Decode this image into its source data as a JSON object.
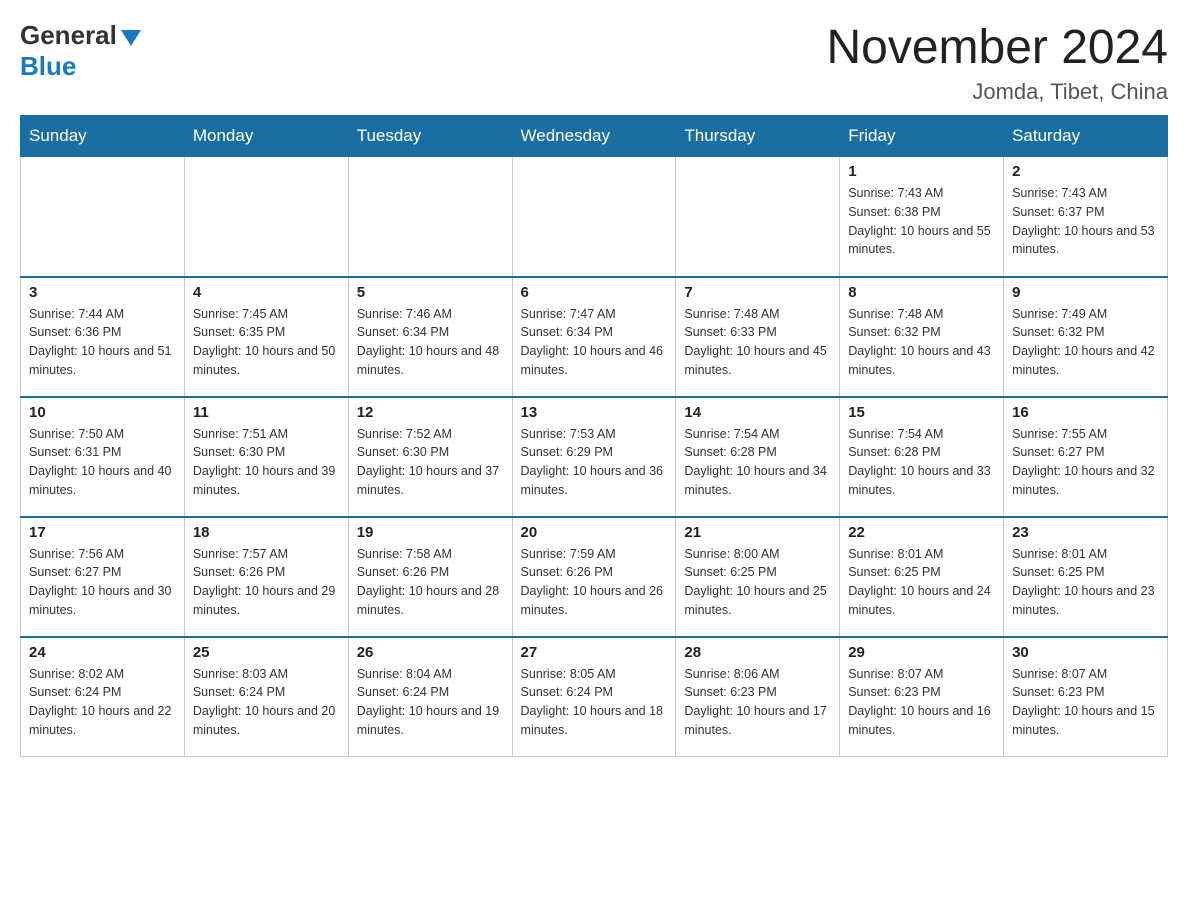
{
  "logo": {
    "general": "General",
    "blue": "Blue"
  },
  "title": "November 2024",
  "location": "Jomda, Tibet, China",
  "days_of_week": [
    "Sunday",
    "Monday",
    "Tuesday",
    "Wednesday",
    "Thursday",
    "Friday",
    "Saturday"
  ],
  "weeks": [
    [
      {
        "day": "",
        "info": ""
      },
      {
        "day": "",
        "info": ""
      },
      {
        "day": "",
        "info": ""
      },
      {
        "day": "",
        "info": ""
      },
      {
        "day": "",
        "info": ""
      },
      {
        "day": "1",
        "info": "Sunrise: 7:43 AM\nSunset: 6:38 PM\nDaylight: 10 hours and 55 minutes."
      },
      {
        "day": "2",
        "info": "Sunrise: 7:43 AM\nSunset: 6:37 PM\nDaylight: 10 hours and 53 minutes."
      }
    ],
    [
      {
        "day": "3",
        "info": "Sunrise: 7:44 AM\nSunset: 6:36 PM\nDaylight: 10 hours and 51 minutes."
      },
      {
        "day": "4",
        "info": "Sunrise: 7:45 AM\nSunset: 6:35 PM\nDaylight: 10 hours and 50 minutes."
      },
      {
        "day": "5",
        "info": "Sunrise: 7:46 AM\nSunset: 6:34 PM\nDaylight: 10 hours and 48 minutes."
      },
      {
        "day": "6",
        "info": "Sunrise: 7:47 AM\nSunset: 6:34 PM\nDaylight: 10 hours and 46 minutes."
      },
      {
        "day": "7",
        "info": "Sunrise: 7:48 AM\nSunset: 6:33 PM\nDaylight: 10 hours and 45 minutes."
      },
      {
        "day": "8",
        "info": "Sunrise: 7:48 AM\nSunset: 6:32 PM\nDaylight: 10 hours and 43 minutes."
      },
      {
        "day": "9",
        "info": "Sunrise: 7:49 AM\nSunset: 6:32 PM\nDaylight: 10 hours and 42 minutes."
      }
    ],
    [
      {
        "day": "10",
        "info": "Sunrise: 7:50 AM\nSunset: 6:31 PM\nDaylight: 10 hours and 40 minutes."
      },
      {
        "day": "11",
        "info": "Sunrise: 7:51 AM\nSunset: 6:30 PM\nDaylight: 10 hours and 39 minutes."
      },
      {
        "day": "12",
        "info": "Sunrise: 7:52 AM\nSunset: 6:30 PM\nDaylight: 10 hours and 37 minutes."
      },
      {
        "day": "13",
        "info": "Sunrise: 7:53 AM\nSunset: 6:29 PM\nDaylight: 10 hours and 36 minutes."
      },
      {
        "day": "14",
        "info": "Sunrise: 7:54 AM\nSunset: 6:28 PM\nDaylight: 10 hours and 34 minutes."
      },
      {
        "day": "15",
        "info": "Sunrise: 7:54 AM\nSunset: 6:28 PM\nDaylight: 10 hours and 33 minutes."
      },
      {
        "day": "16",
        "info": "Sunrise: 7:55 AM\nSunset: 6:27 PM\nDaylight: 10 hours and 32 minutes."
      }
    ],
    [
      {
        "day": "17",
        "info": "Sunrise: 7:56 AM\nSunset: 6:27 PM\nDaylight: 10 hours and 30 minutes."
      },
      {
        "day": "18",
        "info": "Sunrise: 7:57 AM\nSunset: 6:26 PM\nDaylight: 10 hours and 29 minutes."
      },
      {
        "day": "19",
        "info": "Sunrise: 7:58 AM\nSunset: 6:26 PM\nDaylight: 10 hours and 28 minutes."
      },
      {
        "day": "20",
        "info": "Sunrise: 7:59 AM\nSunset: 6:26 PM\nDaylight: 10 hours and 26 minutes."
      },
      {
        "day": "21",
        "info": "Sunrise: 8:00 AM\nSunset: 6:25 PM\nDaylight: 10 hours and 25 minutes."
      },
      {
        "day": "22",
        "info": "Sunrise: 8:01 AM\nSunset: 6:25 PM\nDaylight: 10 hours and 24 minutes."
      },
      {
        "day": "23",
        "info": "Sunrise: 8:01 AM\nSunset: 6:25 PM\nDaylight: 10 hours and 23 minutes."
      }
    ],
    [
      {
        "day": "24",
        "info": "Sunrise: 8:02 AM\nSunset: 6:24 PM\nDaylight: 10 hours and 22 minutes."
      },
      {
        "day": "25",
        "info": "Sunrise: 8:03 AM\nSunset: 6:24 PM\nDaylight: 10 hours and 20 minutes."
      },
      {
        "day": "26",
        "info": "Sunrise: 8:04 AM\nSunset: 6:24 PM\nDaylight: 10 hours and 19 minutes."
      },
      {
        "day": "27",
        "info": "Sunrise: 8:05 AM\nSunset: 6:24 PM\nDaylight: 10 hours and 18 minutes."
      },
      {
        "day": "28",
        "info": "Sunrise: 8:06 AM\nSunset: 6:23 PM\nDaylight: 10 hours and 17 minutes."
      },
      {
        "day": "29",
        "info": "Sunrise: 8:07 AM\nSunset: 6:23 PM\nDaylight: 10 hours and 16 minutes."
      },
      {
        "day": "30",
        "info": "Sunrise: 8:07 AM\nSunset: 6:23 PM\nDaylight: 10 hours and 15 minutes."
      }
    ]
  ]
}
